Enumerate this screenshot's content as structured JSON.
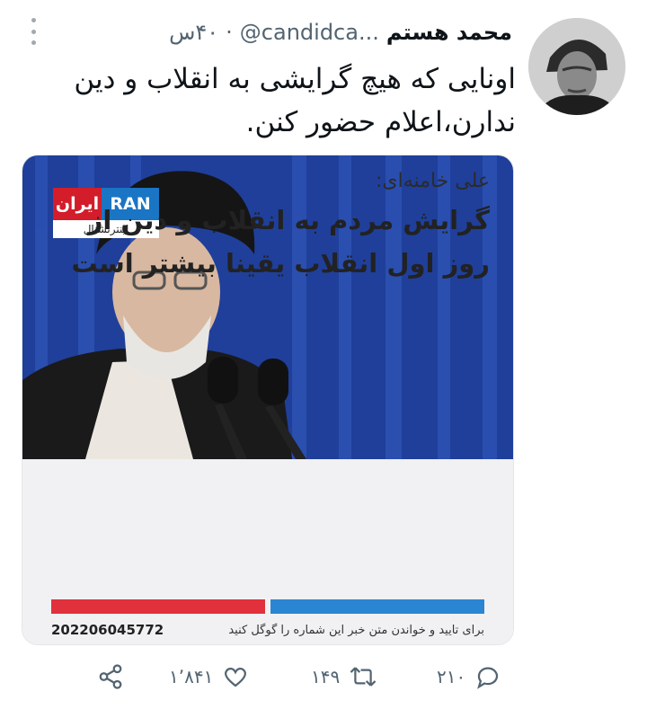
{
  "tweet": {
    "display_name": "محمد هستم",
    "handle": "@candidca...",
    "separator": "·",
    "time": "۴۰س",
    "text": "اونایی که هیچ گرایشی به انقلاب و دین ندارن،اعلام حضور کنن."
  },
  "media": {
    "logo_red": "ایران",
    "logo_blue": "RAN",
    "logo_sub": "اینترنشنال",
    "caption_name": "علی خامنه‌ای:",
    "caption_headline": "گرایش مردم به انقلاب و دین از روز اول انقلاب یقینا بیشتر است",
    "footer_text": "برای تایید و خواندن متن خبر این شماره را گوگل کنید",
    "footer_number": "202206045772"
  },
  "actions": {
    "replies": "۲۱۰",
    "retweets": "۱۴۹",
    "likes": "۱٬۸۴۱"
  },
  "icons": [
    "more-icon",
    "reply-icon",
    "retweet-icon",
    "like-icon",
    "share-icon"
  ],
  "colors": {
    "meta_gray": "#536471",
    "logo_red": "#d31d2a",
    "logo_blue": "#1a75c4",
    "curtain_blue": "#1f3f9a"
  }
}
